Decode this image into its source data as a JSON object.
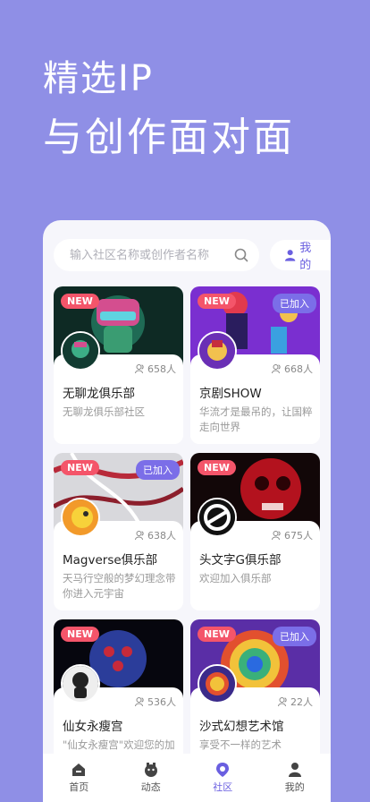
{
  "hero": {
    "line1": "精选IP",
    "line2": "与创作面对面"
  },
  "search": {
    "placeholder": "输入社区名称或创作者名称",
    "mine_label": "我的"
  },
  "cards": [
    {
      "badge_new": "NEW",
      "badge_joined": "",
      "count": "658人",
      "title": "无聊龙俱乐部",
      "desc": "无聊龙俱乐部社区"
    },
    {
      "badge_new": "NEW",
      "badge_joined": "已加入",
      "count": "668人",
      "title": "京剧SHOW",
      "desc": "华流才是最吊的，让国粹走向世界"
    },
    {
      "badge_new": "NEW",
      "badge_joined": "已加入",
      "count": "638人",
      "title": "Magverse俱乐部",
      "desc": "天马行空般的梦幻理念带你进入元宇宙"
    },
    {
      "badge_new": "NEW",
      "badge_joined": "",
      "count": "675人",
      "title": "头文字G俱乐部",
      "desc": "欢迎加入俱乐部"
    },
    {
      "badge_new": "NEW",
      "badge_joined": "",
      "count": "536人",
      "title": "仙女永瘦宫",
      "desc": "\"仙女永瘦宫\"欢迎您的加"
    },
    {
      "badge_new": "NEW",
      "badge_joined": "已加入",
      "count": "22人",
      "title": "沙式幻想艺术馆",
      "desc": "享受不一样的艺术"
    }
  ],
  "tabs": [
    {
      "label": "首页",
      "icon": "home-icon"
    },
    {
      "label": "动态",
      "icon": "activity-icon"
    },
    {
      "label": "社区",
      "icon": "community-icon",
      "active": true
    },
    {
      "label": "我的",
      "icon": "profile-icon"
    }
  ],
  "colors": {
    "background": "#8f8fe6",
    "accent": "#6a5fe0",
    "new_badge": "#f4556a",
    "joined_badge": "#7b6ee8"
  }
}
